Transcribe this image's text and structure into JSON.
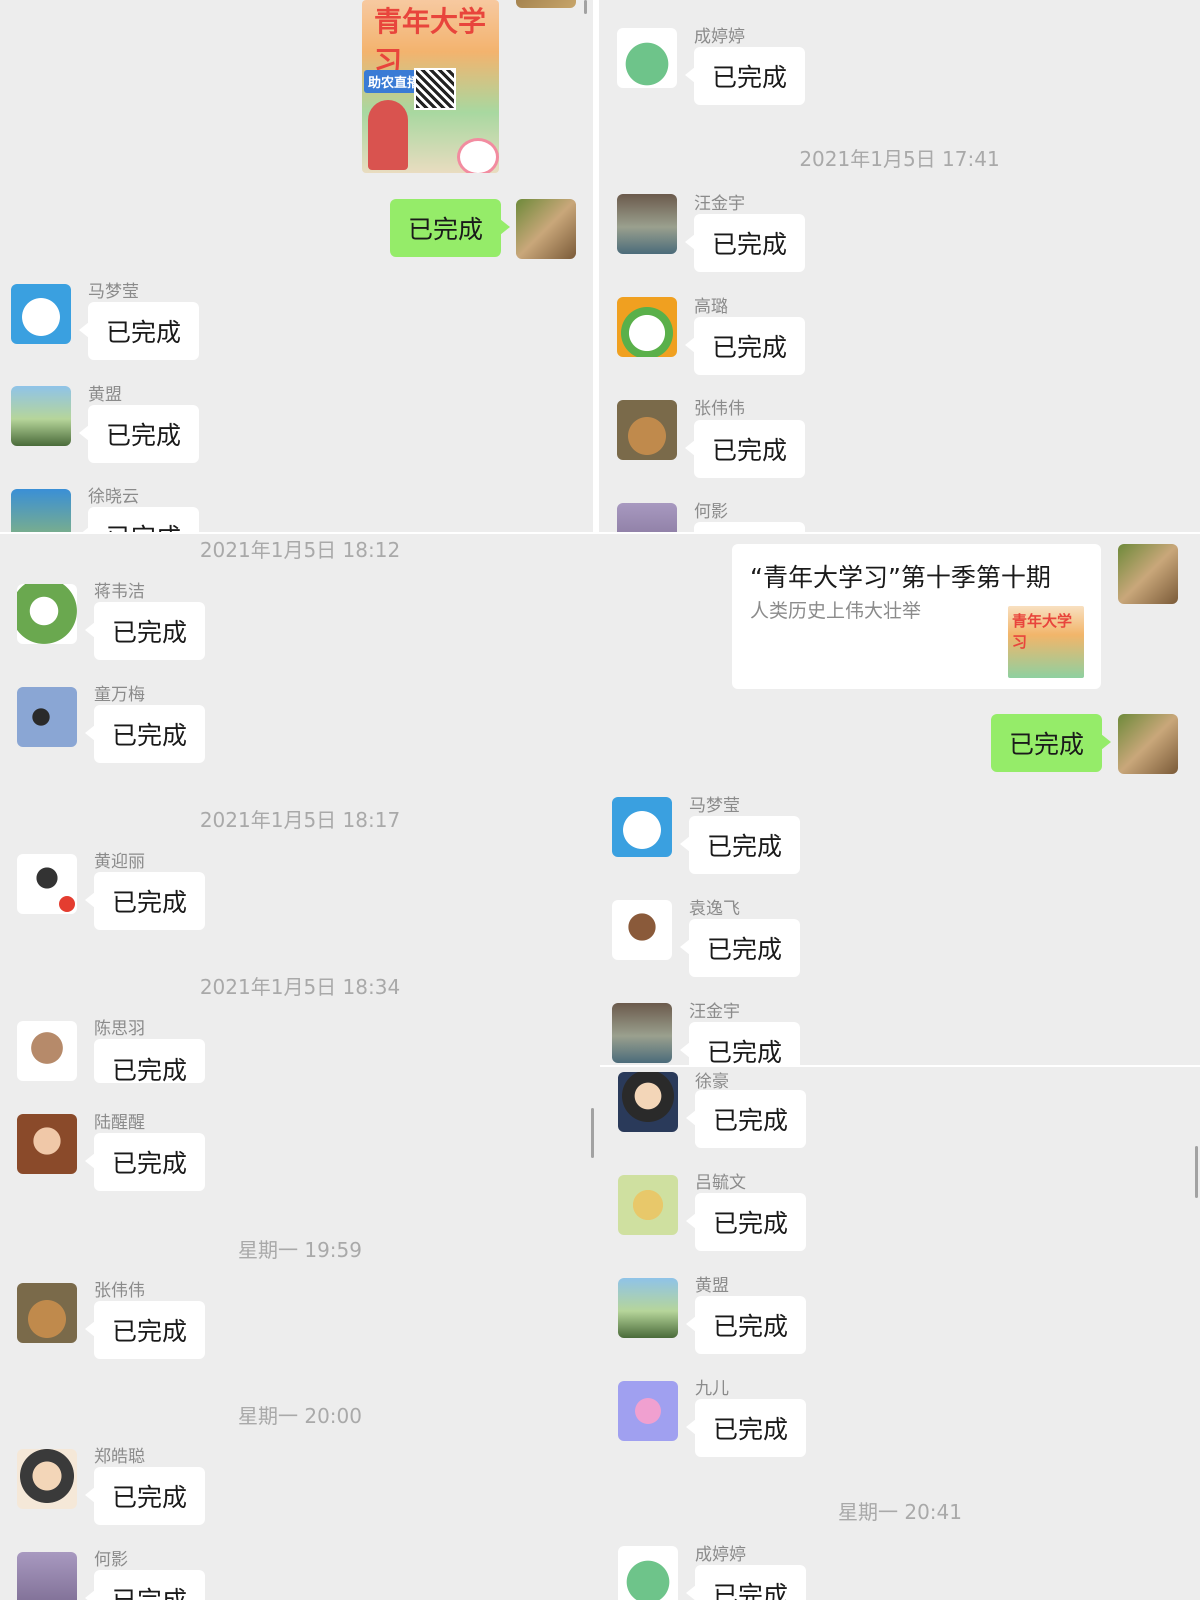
{
  "status_label": "已完成",
  "card": {
    "title": "“青年大学习”第十季第十期",
    "subtitle": "人类历史上伟大壮举",
    "thumb_text": "青年大学习"
  },
  "poster": {
    "title": "青年大学习",
    "badge": "助农直播"
  },
  "timestamps": {
    "tl_1": "2021年1月5日 17:41",
    "bl_1": "2021年1月5日 18:12",
    "bl_2": "2021年1月5日 18:17",
    "bl_3": "2021年1月5日 18:34",
    "bl_4": "星期一 19:59",
    "bl_5": "星期一 20:00",
    "br_1": "星期一 20:41"
  },
  "names": {
    "tl_ma": "马梦莹",
    "tl_huangmeng": "黄盟",
    "tl_xu": "徐晓云",
    "tr_cheng": "成婷婷",
    "tr_wang": "汪金宇",
    "tr_gao": "高璐",
    "tr_zhang": "张伟伟",
    "tr_he": "何影",
    "bl_jiang": "蒋韦洁",
    "bl_tong": "童万梅",
    "bl_huangying": "黄迎丽",
    "bl_chen": "陈思羽",
    "bl_lu": "陆醒醒",
    "bl_zhang": "张伟伟",
    "bl_zheng": "郑皓聪",
    "bl_he": "何影",
    "br_ma": "马梦莹",
    "br_yuan": "袁逸飞",
    "br_wang": "汪金宇",
    "br_xuhao": "徐豪",
    "br_lv": "吕毓文",
    "br_huangmeng": "黄盟",
    "br_jiuer": "九儿",
    "br_cheng": "成婷婷"
  },
  "colors": {
    "background": "#ededed",
    "bubble_self": "#95ec69",
    "bubble_other": "#ffffff",
    "timestamp": "#a9a9a9"
  }
}
